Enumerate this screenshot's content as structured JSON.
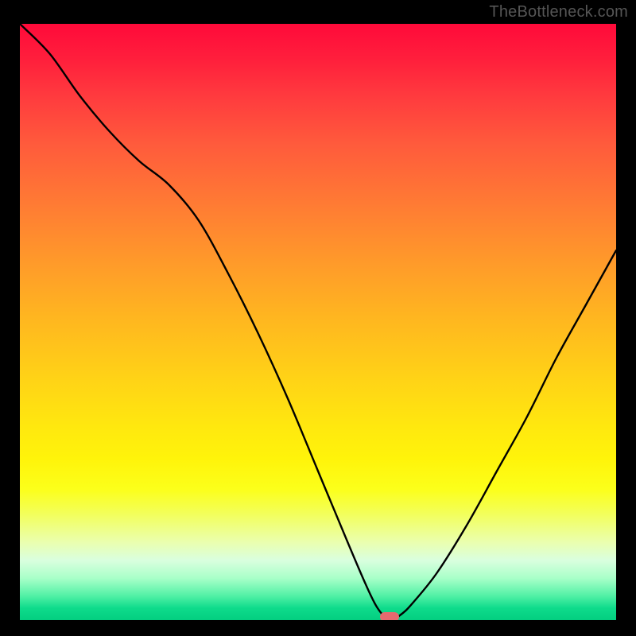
{
  "watermark": "TheBottleneck.com",
  "chart_data": {
    "type": "line",
    "title": "",
    "xlabel": "",
    "ylabel": "",
    "xlim": [
      0,
      100
    ],
    "ylim": [
      0,
      100
    ],
    "grid": false,
    "notes": "Background is a vertical color gradient from red (top, high bottleneck) through orange/yellow to green (bottom, balanced). Black curve shows bottleneck vs. x with a minimum near x≈62. A small red pill marker sits at the curve minimum near the baseline.",
    "series": [
      {
        "name": "bottleneck-curve",
        "color": "#000000",
        "x": [
          0,
          5,
          10,
          15,
          20,
          25,
          30,
          35,
          40,
          45,
          50,
          55,
          58,
          60,
          62,
          64,
          66,
          70,
          75,
          80,
          85,
          90,
          95,
          100
        ],
        "values": [
          100,
          95,
          88,
          82,
          77,
          73,
          67,
          58,
          48,
          37,
          25,
          13,
          6,
          2,
          0,
          1,
          3,
          8,
          16,
          25,
          34,
          44,
          53,
          62
        ]
      }
    ],
    "marker": {
      "x": 62,
      "y": 0,
      "color": "#e46a6f"
    },
    "gradient_stops": [
      {
        "pos": 0,
        "color": "#ff0a3a"
      },
      {
        "pos": 20,
        "color": "#ff5a3c"
      },
      {
        "pos": 40,
        "color": "#ff9a2a"
      },
      {
        "pos": 60,
        "color": "#ffd416"
      },
      {
        "pos": 78,
        "color": "#fcff1a"
      },
      {
        "pos": 90,
        "color": "#d9ffdf"
      },
      {
        "pos": 100,
        "color": "#03ce80"
      }
    ]
  }
}
